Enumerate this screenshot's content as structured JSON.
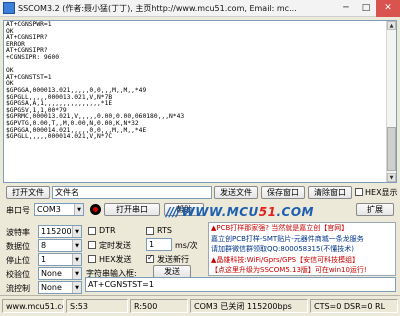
{
  "window": {
    "title": "SSCOM3.2 (作者:聂小猛(丁丁), 主页http://www.mcu51.com,  Email: mc...",
    "minimize": "─",
    "maximize": "□",
    "close": "✕"
  },
  "terminal": {
    "lines": [
      "AT+CGNSPWR=1",
      "OK",
      "AT+CGNSIPR?",
      "ERROR",
      "AT+CGNSIPR?",
      "+CGNSIPR: 9600",
      "",
      "OK",
      "AT+CGNSTST=1",
      "OK",
      "$GPGGA,000013.021,,,,,0,0,,,M,,M,,*49",
      "$GPGLL,,,,,000013.021,V,N*7B",
      "$GPGSA,A,1,,,,,,,,,,,,,,,*1E",
      "$GPGSV,1,1,00*79",
      "$GPRMC,000013.021,V,,,,,0.00,0.00,060180,,,N*43",
      "$GPVTG,0.00,T,,M,0.00,N,0.00,K,N*32",
      "$GPGGA,000014.021,,,,,0,0,,,M,,M,,*4E",
      "$GPGLL,,,,,000014.021,V,N*7C"
    ]
  },
  "toolbar": {
    "open_file": "打开文件",
    "file_name": "文件名",
    "send_file": "发送文件",
    "save_window": "保存窗口",
    "clear_window": "清除窗口",
    "hex_display": "HEX显示"
  },
  "port": {
    "label": "串口号",
    "value": "COM3",
    "open_button": "打开串口",
    "help_button": "帮助",
    "expand_button": "扩展"
  },
  "logo": {
    "lead": "////",
    "text_a": "WWW.MCU",
    "text_num": "51",
    "text_b": ".COM"
  },
  "settings": {
    "baud_label": "波特率",
    "baud_value": "115200",
    "data_bits_label": "数据位",
    "data_bits_value": "8",
    "stop_bits_label": "停止位",
    "stop_bits_value": "1",
    "parity_label": "校验位",
    "parity_value": "None",
    "flow_label": "流控制",
    "flow_value": "None"
  },
  "options": {
    "dtr": "DTR",
    "rts": "RTS",
    "timed_send": "定时发送",
    "interval_value": "1",
    "interval_unit": "ms/次",
    "hex_send": "HEX发送",
    "send_newline": "发送新行",
    "input_label": "字符串输入框:",
    "send_button": "发送"
  },
  "ads": {
    "lines": [
      "▲PCB打样那家强? 当然就是嘉立创【官网】",
      "嘉立创PCB打样-SMT贴片-元器件商城一条龙服务",
      "请加群微信群领取QQ:800058315(不懂技术)",
      "▲晶雄科技:WiFi/Gprs/GPS【安信可科技模组】",
      "【点这里升级为SSCOM5.13版】可在win10运行!"
    ]
  },
  "send_input": {
    "value": "AT+CGNSTST=1"
  },
  "status": {
    "website": "www.mcu51.cor",
    "sent": "S:53",
    "received": "R:500",
    "port_state": "COM3 已关闭  115200bps",
    "lines": "CTS=0 DSR=0 RL"
  }
}
